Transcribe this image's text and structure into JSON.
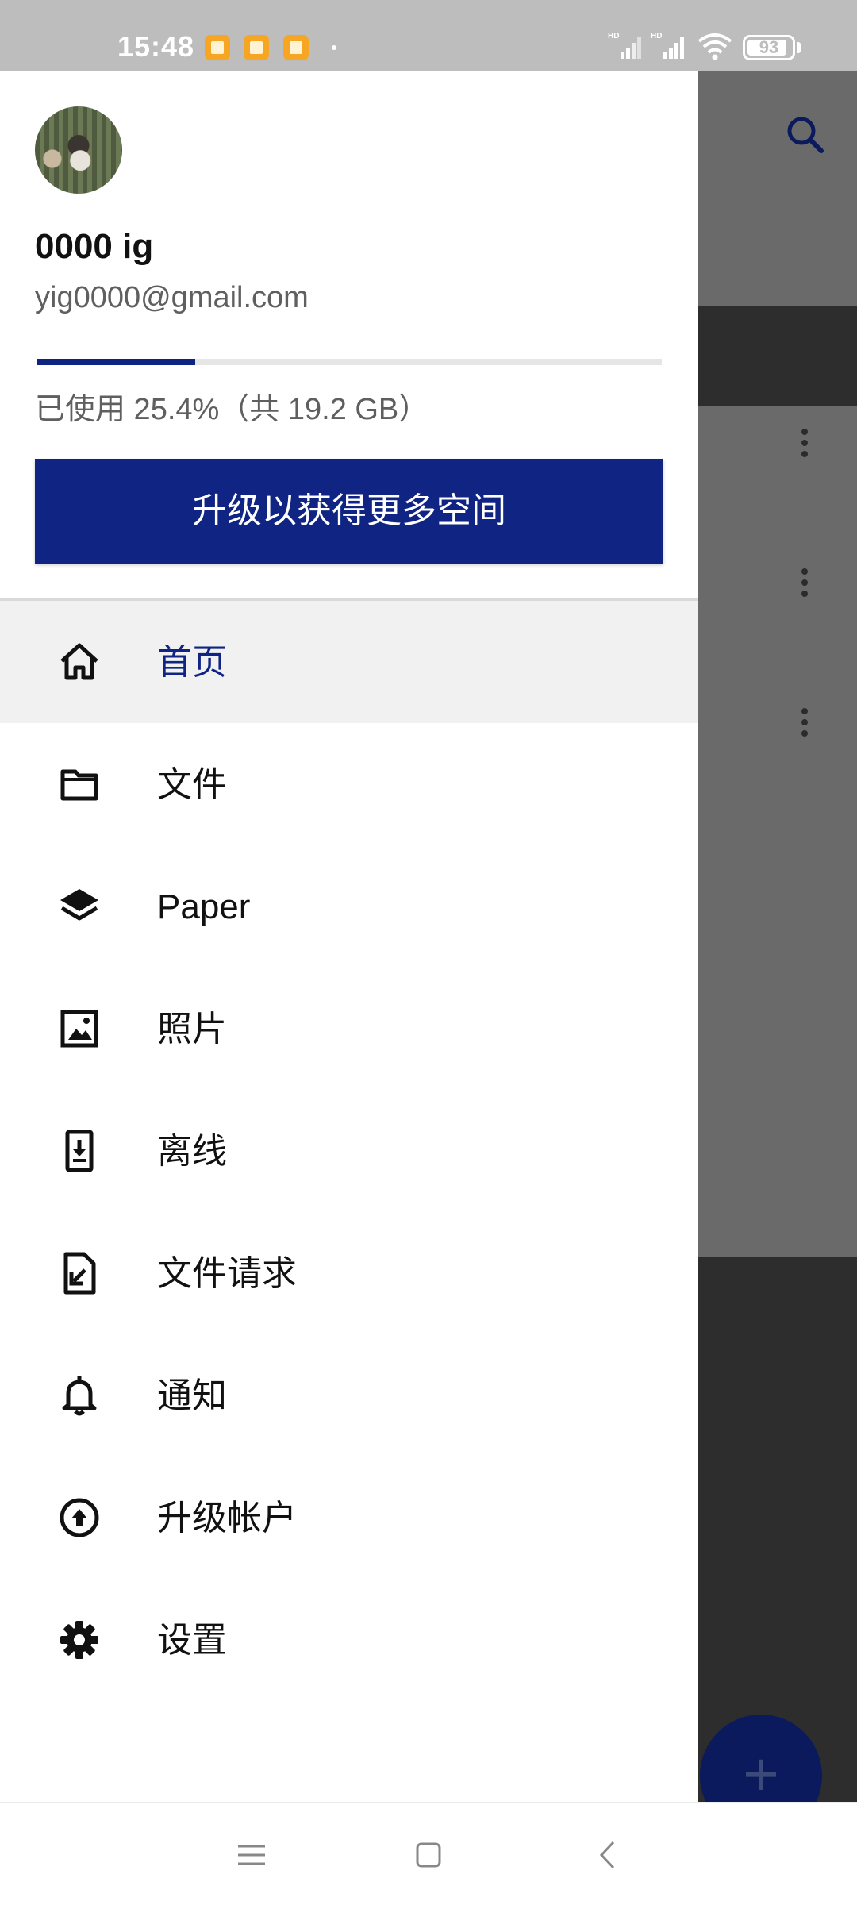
{
  "status_bar": {
    "time": "15:48",
    "notification_icons": [
      "notification-app-icon",
      "notification-app-icon",
      "notification-app-icon"
    ],
    "battery_level": "93",
    "network": [
      "hd-signal-icon",
      "hd-signal-icon",
      "wifi-icon"
    ]
  },
  "drawer": {
    "user": {
      "name": "0000 ig",
      "email": "yig0000@gmail.com"
    },
    "storage": {
      "used_fraction": 0.254,
      "text": "已使用 25.4%（共 19.2 GB）"
    },
    "upgrade_button_label": "升级以获得更多空间",
    "menu": [
      {
        "label": "首页",
        "icon": "home-icon",
        "active": true
      },
      {
        "label": "文件",
        "icon": "folder-icon",
        "active": false
      },
      {
        "label": "Paper",
        "icon": "paper-layers-icon",
        "active": false
      },
      {
        "label": "照片",
        "icon": "photo-icon",
        "active": false
      },
      {
        "label": "离线",
        "icon": "offline-device-icon",
        "active": false
      },
      {
        "label": "文件请求",
        "icon": "file-request-icon",
        "active": false
      },
      {
        "label": "通知",
        "icon": "bell-icon",
        "active": false
      },
      {
        "label": "升级帐户",
        "icon": "upgrade-arrow-icon",
        "active": false
      },
      {
        "label": "设置",
        "icon": "gear-icon",
        "active": false
      }
    ]
  },
  "background_app": {
    "icons": [
      "search-icon",
      "more-vert-icon",
      "add-icon"
    ],
    "fab_label": "+"
  },
  "colors": {
    "accent": "#0f2483",
    "active_item_bg": "#f1f1f1",
    "scrim_gray": "#6a6a6a",
    "status_bar_bg": "#bdbdbd"
  },
  "nav_bar": {
    "buttons": [
      "menu-nav-icon",
      "home-nav-icon",
      "back-nav-icon"
    ]
  }
}
